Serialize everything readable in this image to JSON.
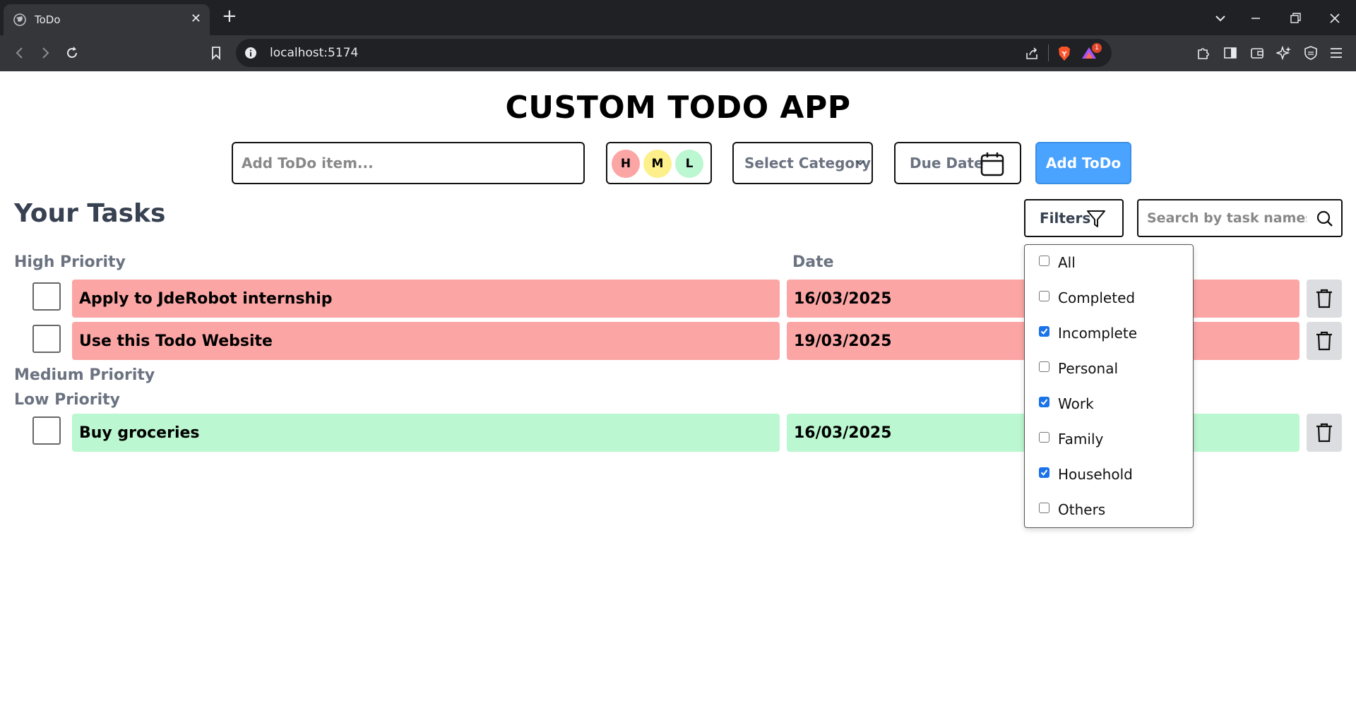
{
  "browser": {
    "tab_title": "ToDo",
    "tab_close": "✕",
    "new_tab": "+",
    "url": "localhost:5174",
    "brave_badge": "1"
  },
  "app": {
    "title": "CUSTOM TODO APP",
    "add_placeholder": "Add ToDo item...",
    "priorities": [
      {
        "label": "H",
        "color": "#fca5a5"
      },
      {
        "label": "M",
        "color": "#fdf08a"
      },
      {
        "label": "L",
        "color": "#bbf7d0"
      }
    ],
    "category_select": "Select Category",
    "due_date_label": "Due Date",
    "add_button": "Add ToDo",
    "section_title": "Your Tasks",
    "filters_label": "Filters",
    "search_placeholder": "Search by task names",
    "date_header": "Date",
    "groups": {
      "high": "High Priority",
      "medium": "Medium Priority",
      "low": "Low Priority"
    },
    "tasks": [
      {
        "name": "Apply to JdeRobot internship",
        "date": "16/03/2025",
        "priority": "high"
      },
      {
        "name": "Use this Todo Website",
        "date": "19/03/2025",
        "priority": "high"
      },
      {
        "name": "Buy groceries",
        "date": "16/03/2025",
        "priority": "low"
      }
    ],
    "filter_options": [
      {
        "label": "All",
        "checked": false
      },
      {
        "label": "Completed",
        "checked": false
      },
      {
        "label": "Incomplete",
        "checked": true
      },
      {
        "label": "Personal",
        "checked": false
      },
      {
        "label": "Work",
        "checked": true
      },
      {
        "label": "Family",
        "checked": false
      },
      {
        "label": "Household",
        "checked": true
      },
      {
        "label": "Others",
        "checked": false
      }
    ]
  },
  "colors": {
    "high_row": "#fca5a5",
    "low_row": "#bbf7d0",
    "accent": "#4aa3ff"
  }
}
